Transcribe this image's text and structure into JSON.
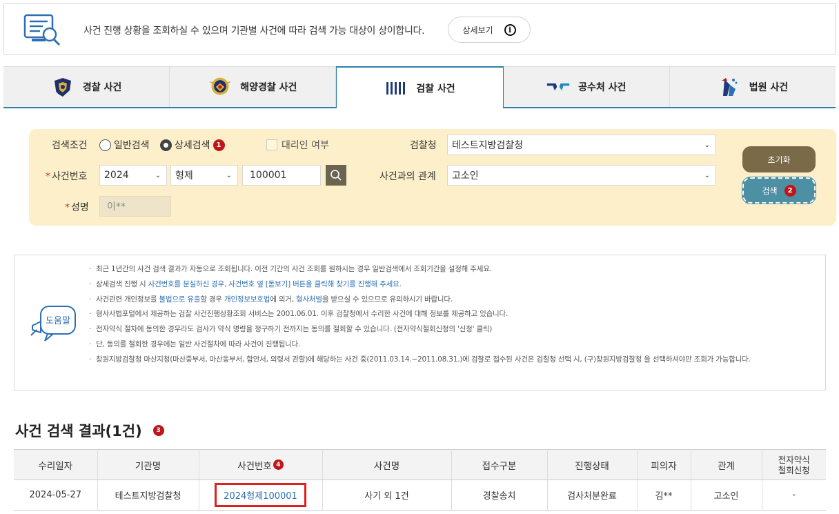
{
  "banner": {
    "icon": "document-search-icon",
    "text": "사건 진행 상황을 조회하실 수 있으며 기관별 사건에 따라 검색 가능 대상이 상이합니다.",
    "detail_button": "상세보기",
    "detail_icon": "info-icon"
  },
  "tabs": [
    {
      "label": "경찰 사건",
      "icon": "police-badge-icon",
      "active": false
    },
    {
      "label": "해양경찰 사건",
      "icon": "coast-guard-badge-icon",
      "active": false
    },
    {
      "label": "검찰 사건",
      "icon": "prosecution-logo-icon",
      "active": true
    },
    {
      "label": "공수처 사건",
      "icon": "cio-logo-icon",
      "active": false
    },
    {
      "label": "법원 사건",
      "icon": "court-logo-icon",
      "active": false
    }
  ],
  "search": {
    "condition_label": "검색조건",
    "radio_general": "일반검색",
    "radio_detail": "상세검색",
    "badge_1": "1",
    "proxy_label": "대리인 여부",
    "office_label": "검찰청",
    "office_value": "테스트지방검찰청",
    "case_no_label": "사건번호",
    "year_value": "2024",
    "type_value": "형제",
    "number_value": "100001",
    "relation_label": "사건과의 관계",
    "relation_value": "고소인",
    "name_label": "성명",
    "name_value": "이**",
    "reset_button": "초기화",
    "search_button": "검색",
    "badge_2": "2",
    "required_mark": "*"
  },
  "help": {
    "icon_label": "도움말",
    "lines": {
      "l1": "최근 1년간의 사건 검색 결과가 자동으로 조회됩니다. 이전 기간의 사건 조회를 원하시는 경우 일반검색에서 조회기간을 설정해 주세요.",
      "l2a": "상세검색 진행 시 ",
      "l2b": "사건번호를 분실하신 경우, 사건번호 옆 [돋보기] 버튼을 클릭해 찾기를 진행해 주세요.",
      "l3a": "사건관련 개인정보를 ",
      "l3b": "불법으로 유출",
      "l3c": "할 경우 ",
      "l3d": "개인정보보호법",
      "l3e": "에 의거, ",
      "l3f": "형사처벌",
      "l3g": "을 받으실 수 있으므로 유의하시기 바랍니다.",
      "l4": "형사사법포털에서 제공하는 검찰 사건진행상황조회 서비스는 2001.06.01. 이후 검찰청에서 수리한 사건에 대해 정보를 제공하고 있습니다.",
      "l5": "전자약식 절차에 동의한 경우라도 검사가 약식 명령을 청구하기 전까지는 동의를 철회할 수 있습니다. (전자약식철회신청의 '신청' 클릭)",
      "l6": "단, 동의를 철회한 경우에는 일반 사건절차에 따라 사건이 진행됩니다.",
      "l7": "창원지방검찰청 마산지청(마산중부서, 마산동부서, 함안서, 의령서 관할)에 해당하는 사건 중(2011.03.14.~2011.08.31.)에 검찰로 접수된 사건은 검찰청 선택 시, (구)창원지방검찰청 을 선택하셔야만 조회가 가능합니다."
    }
  },
  "results": {
    "title": "사건 검색 결과(1건)",
    "badge_3": "3",
    "badge_4": "4",
    "headers": {
      "date": "수리일자",
      "agency": "기관명",
      "case_no": "사건번호",
      "case_name": "사건명",
      "receipt": "접수구분",
      "status": "진행상태",
      "suspect": "피의자",
      "relation": "관계",
      "ewithdraw_1": "전자약식",
      "ewithdraw_2": "철회신청"
    },
    "row": {
      "date": "2024-05-27",
      "agency": "테스트지방검찰청",
      "case_no": "2024형제100001",
      "case_name": "사기 외 1건",
      "receipt": "경찰송치",
      "status": "검사처분완료",
      "suspect": "김**",
      "relation": "고소인",
      "ewithdraw": "-"
    }
  },
  "colors": {
    "accent_blue": "#2e7fa8",
    "search_bg": "#fcefc9",
    "reset_btn": "#7a6a47",
    "search_btn": "#4d8fa3",
    "badge_red": "#c0161b",
    "link_blue": "#2e6fb3",
    "highlight_red": "#e02020"
  }
}
